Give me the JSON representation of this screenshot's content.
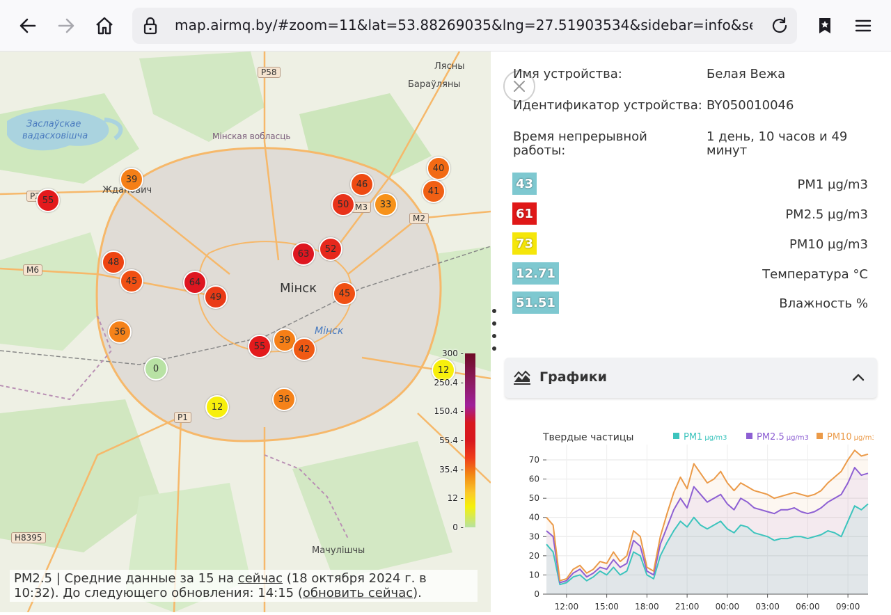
{
  "browser": {
    "url": "map.airmq.by/#zoom=11&lat=53.88269035&lng=27.51903534&sidebar=info&selectedLo...",
    "icons": [
      "back-icon",
      "forward-icon",
      "home-icon",
      "lock-icon",
      "reload-icon",
      "bookmark-star-icon",
      "menu-icon"
    ]
  },
  "map": {
    "labels": {
      "city": "Мiнск",
      "city_district": "Мiнск",
      "reservoir_line1": "Заслаўскае",
      "reservoir_line2": "вадасховiшча",
      "zhdanovichi": "Жданович",
      "region": "Мiнская вобласць",
      "lyasny": "Лясны",
      "barauliany": "Бараўляны",
      "machulishchy": "Мачулiшчы",
      "region2": "Мiнска"
    },
    "road_signs": {
      "p58": "P58",
      "m6": "M6",
      "m2": "M2",
      "p1": "P1",
      "h8395": "H8395",
      "p28": "P2",
      "m3": "M3"
    },
    "markers": [
      {
        "value": "55",
        "color": "#e31a1c"
      },
      {
        "value": "39",
        "color": "#f57f17"
      },
      {
        "value": "46",
        "color": "#ee4a12"
      },
      {
        "value": "50",
        "color": "#e8321a"
      },
      {
        "value": "33",
        "color": "#f7921a"
      },
      {
        "value": "40",
        "color": "#f26a14"
      },
      {
        "value": "41",
        "color": "#f06014"
      },
      {
        "value": "48",
        "color": "#ee4412"
      },
      {
        "value": "45",
        "color": "#f05014"
      },
      {
        "value": "64",
        "color": "#de1620"
      },
      {
        "value": "49",
        "color": "#ea3a16"
      },
      {
        "value": "63",
        "color": "#de1620"
      },
      {
        "value": "52",
        "color": "#e6281c"
      },
      {
        "value": "45",
        "color": "#f05014"
      },
      {
        "value": "36",
        "color": "#f58219"
      },
      {
        "value": "55",
        "color": "#e31a1c"
      },
      {
        "value": "39",
        "color": "#f57f17"
      },
      {
        "value": "42",
        "color": "#f05a14"
      },
      {
        "value": "0",
        "color": "#b8e2a4"
      },
      {
        "value": "12",
        "color": "#f7ef0c"
      },
      {
        "value": "36",
        "color": "#f58219"
      },
      {
        "value": "12",
        "color": "#f7ef0c"
      }
    ],
    "legend_ticks": [
      "300 -",
      "250.4 -",
      "150.4 -",
      "55.4 -",
      "35.4 -",
      "12 -",
      "0 -"
    ],
    "caption": {
      "prefix": "PM2.5 | Средние данные за 15 на ",
      "link_now": "сейчас",
      "middle": " (18 октября 2024 г. в 10:32). До следующего обновления: 14:15 (",
      "link_update": "обновить сейчас",
      "suffix": ")."
    }
  },
  "sidebar": {
    "device_name_label": "Имя устройства:",
    "device_name_value": "Белая Вежа",
    "device_id_label": "Идентификатор устройства:",
    "device_id_value": "BY050010046",
    "uptime_label_1": "Время непрерывной",
    "uptime_label_2": "работы:",
    "uptime_value_1": "1 день, 10 часов и 49",
    "uptime_value_2": "минут",
    "metrics": [
      {
        "value": "43",
        "label": "PM1 µg/m3",
        "color": "#7ec8d0"
      },
      {
        "value": "61",
        "label": "PM2.5 µg/m3",
        "color": "#e01818"
      },
      {
        "value": "73",
        "label": "PM10 µg/m3",
        "color": "#f5e60a"
      },
      {
        "value": "12.71",
        "label": "Температура °C",
        "color": "#7ec8d0"
      },
      {
        "value": "51.51",
        "label": "Влажность %",
        "color": "#7ec8d0"
      }
    ],
    "charts_title": "Графики"
  },
  "chart_data": {
    "type": "line",
    "title": "Твердые частицы",
    "series_names": [
      "PM1",
      "PM2.5",
      "PM10"
    ],
    "series_units": "µg/m3",
    "colors": {
      "PM1": "#3cc4bd",
      "PM2.5": "#8d5fd3",
      "PM10": "#eb9a48"
    },
    "x_ticks": [
      "12:00",
      "15:00",
      "18:00",
      "21:00",
      "00:00",
      "03:00",
      "06:00",
      "09:00"
    ],
    "y_ticks": [
      0,
      10,
      20,
      30,
      40,
      50,
      60,
      70
    ],
    "ylim": [
      0,
      78
    ],
    "x_hours": [
      10.5,
      11,
      11.5,
      12,
      12.5,
      13,
      13.5,
      14,
      14.5,
      15,
      15.5,
      16,
      16.5,
      17,
      17.5,
      18,
      18.5,
      19,
      19.5,
      20,
      20.5,
      21,
      21.5,
      22,
      22.5,
      23,
      23.5,
      24,
      24.5,
      25,
      25.5,
      26,
      26.5,
      27,
      27.5,
      28,
      28.5,
      29,
      29.5,
      30,
      30.5,
      31,
      31.5,
      32,
      32.5,
      33,
      33.5,
      34,
      34.5
    ],
    "series": [
      {
        "name": "PM1",
        "values": [
          26,
          22,
          5,
          6,
          9,
          10,
          7,
          9,
          12,
          10,
          14,
          10,
          12,
          22,
          20,
          10,
          8,
          20,
          27,
          33,
          38,
          35,
          40,
          36,
          34,
          36,
          38,
          34,
          32,
          36,
          35,
          32,
          31,
          30,
          28,
          29,
          29,
          30,
          30,
          29,
          30,
          31,
          33,
          32,
          30,
          38,
          46,
          44,
          47
        ]
      },
      {
        "name": "PM2.5",
        "values": [
          33,
          30,
          6,
          7,
          11,
          13,
          9,
          11,
          14,
          13,
          18,
          14,
          16,
          28,
          25,
          12,
          10,
          26,
          35,
          44,
          50,
          45,
          56,
          52,
          48,
          50,
          52,
          47,
          44,
          50,
          48,
          45,
          44,
          43,
          42,
          44,
          44,
          45,
          43,
          42,
          43,
          45,
          48,
          50,
          52,
          58,
          66,
          62,
          63
        ]
      },
      {
        "name": "PM10",
        "values": [
          40,
          36,
          7,
          8,
          13,
          15,
          11,
          13,
          17,
          16,
          22,
          17,
          20,
          33,
          30,
          14,
          12,
          30,
          42,
          53,
          61,
          55,
          68,
          63,
          58,
          60,
          64,
          58,
          54,
          58,
          56,
          54,
          53,
          52,
          50,
          51,
          52,
          53,
          52,
          51,
          52,
          54,
          58,
          61,
          64,
          70,
          75,
          72,
          73
        ]
      }
    ]
  }
}
